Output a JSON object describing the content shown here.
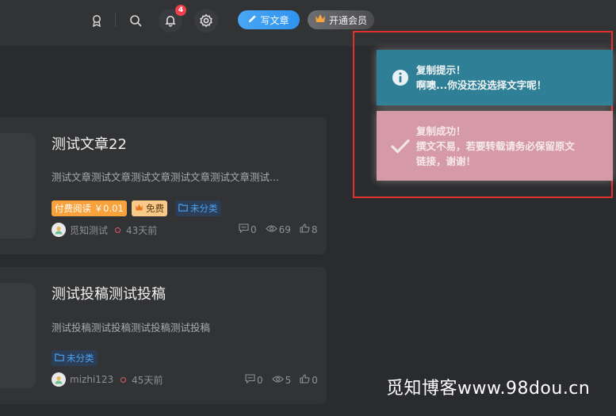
{
  "header": {
    "notification_count": "4",
    "write_label": "写文章",
    "vip_label": "开通会员",
    "icons": [
      "user-award-icon",
      "search-icon",
      "bell-icon",
      "settings-icon",
      "pencil-icon",
      "crown-icon"
    ]
  },
  "posts": [
    {
      "title": "测试文章22",
      "excerpt": "测试文章测试文章测试文章测试文章测试文章测试...",
      "tags": {
        "paid": "付费阅读 ￥0.01",
        "free": "免费",
        "category": "未分类"
      },
      "author": "觅知测试",
      "time": "43天前",
      "comments": "0",
      "views": "69",
      "likes": "8"
    },
    {
      "title": "测试投稿测试投稿",
      "excerpt": "测试投稿测试投稿测试投稿测试投稿",
      "tags": {
        "category": "未分类"
      },
      "author": "mizhi123",
      "time": "45天前",
      "comments": "0",
      "views": "5",
      "likes": "0"
    }
  ],
  "notifications": {
    "info": {
      "title": "复制提示！",
      "message": "啊噢...你没还没选择文字呢！",
      "color": "#2f8097"
    },
    "success": {
      "title": "复制成功！",
      "message_line1": "撰文不易，若要转载请务必保留原文",
      "message_line2": "链接，谢谢！",
      "color": "#d59aa6"
    }
  },
  "watermark": "觅知博客www.98dou.cn",
  "colors": {
    "accent": "#2f93ef",
    "badge": "#f1404b",
    "paid_tag": "#f9a13a",
    "highlight_frame": "#e0312b"
  }
}
